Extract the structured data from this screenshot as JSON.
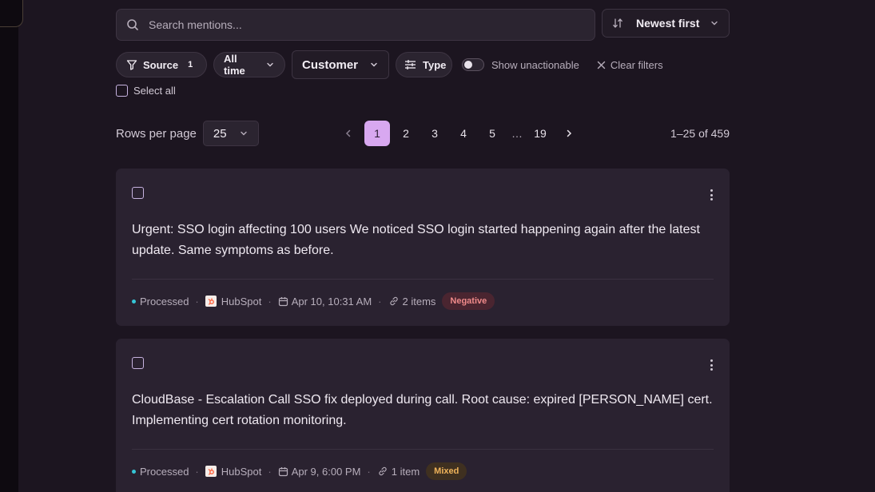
{
  "search": {
    "placeholder": "Search mentions..."
  },
  "sort": {
    "label": "Newest first"
  },
  "filters": {
    "source_label": "Source",
    "source_count": "1",
    "time_label": "All time",
    "customer_label": "Customer",
    "type_label": "Type",
    "show_unactionable": "Show unactionable",
    "show_unactionable_on": false,
    "clear_label": "Clear filters"
  },
  "select_all": "Select all",
  "pagination": {
    "rows_per_page_label": "Rows per page",
    "rows_per_page_value": "25",
    "pages": [
      "1",
      "2",
      "3",
      "4",
      "5",
      "…",
      "19"
    ],
    "current_page": "1",
    "range": "1–25 of 459"
  },
  "mentions": [
    {
      "text": "Urgent: SSO login affecting 100 users We noticed SSO login started happening again after the latest update. Same symptoms as before.",
      "status": "Processed",
      "source": "HubSpot",
      "date": "Apr 10, 10:31 AM",
      "items": "2 items",
      "sentiment": "Negative"
    },
    {
      "text": "CloudBase - Escalation Call SSO fix deployed during call. Root cause: expired [PERSON_NAME] cert. Implementing cert rotation monitoring.",
      "status": "Processed",
      "source": "HubSpot",
      "date": "Apr 9, 6:00 PM",
      "items": "1 item",
      "sentiment": "Mixed"
    }
  ],
  "colors": {
    "background": "#1c1520",
    "card": "#2a2230",
    "accent": "#d8a8f0",
    "status_dot": "#35c6d6",
    "negative": "#f08a8a",
    "mixed": "#f0b35a"
  }
}
